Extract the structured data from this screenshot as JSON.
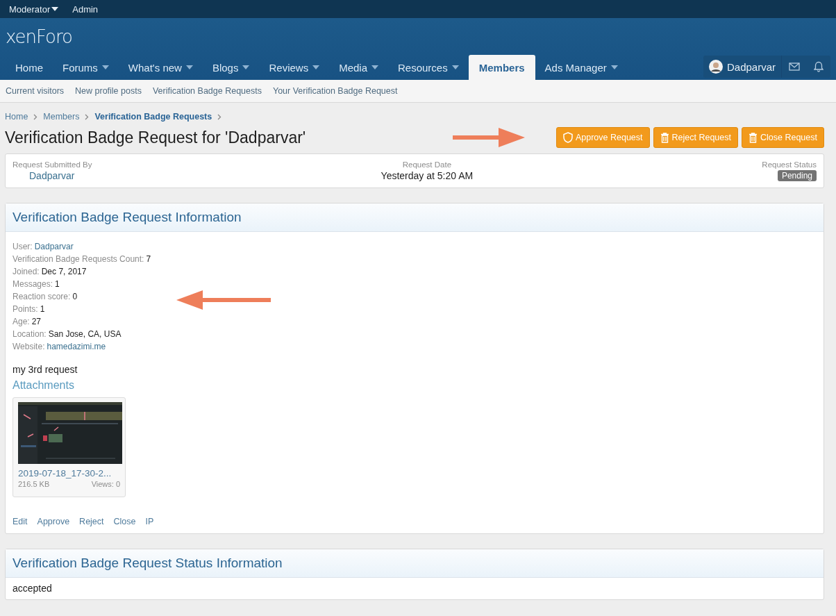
{
  "staff_bar": [
    {
      "label": "Moderator",
      "has_menu": true
    },
    {
      "label": "Admin",
      "has_menu": false
    }
  ],
  "logo": "xenForo",
  "nav": [
    {
      "label": "Home",
      "has_menu": false,
      "selected": false
    },
    {
      "label": "Forums",
      "has_menu": true,
      "selected": false
    },
    {
      "label": "What's new",
      "has_menu": true,
      "selected": false
    },
    {
      "label": "Blogs",
      "has_menu": true,
      "selected": false
    },
    {
      "label": "Reviews",
      "has_menu": true,
      "selected": false
    },
    {
      "label": "Media",
      "has_menu": true,
      "selected": false
    },
    {
      "label": "Resources",
      "has_menu": true,
      "selected": false
    },
    {
      "label": "Members",
      "has_menu": false,
      "selected": true
    },
    {
      "label": "Ads Manager",
      "has_menu": true,
      "selected": false
    }
  ],
  "user": {
    "name": "Dadparvar"
  },
  "sub_nav": [
    "Current visitors",
    "New profile posts",
    "Verification Badge Requests",
    "Your Verification Badge Request"
  ],
  "breadcrumb": [
    {
      "label": "Home",
      "current": false
    },
    {
      "label": "Members",
      "current": false
    },
    {
      "label": "Verification Badge Requests",
      "current": true
    }
  ],
  "title": "Verification Badge Request for 'Dadparvar'",
  "actions": [
    {
      "label": "Approve Request",
      "kind": "shield"
    },
    {
      "label": "Reject Request",
      "kind": "trash"
    },
    {
      "label": "Close Request",
      "kind": "trash"
    }
  ],
  "summary": {
    "submitted_by": {
      "label": "Request Submitted By",
      "value": "Dadparvar"
    },
    "date": {
      "label": "Request Date",
      "value": "Yesterday at 5:20 AM"
    },
    "status": {
      "label": "Request Status",
      "value": "Pending"
    }
  },
  "info": {
    "title": "Verification Badge Request Information",
    "rows": [
      {
        "label": "User:",
        "value": "Dadparvar",
        "kind": "link"
      },
      {
        "label": "Verification Badge Requests Count:",
        "value": "7",
        "kind": "plain"
      },
      {
        "label": "Joined:",
        "value": "Dec 7, 2017",
        "kind": "plain"
      },
      {
        "label": "Messages:",
        "value": "1",
        "kind": "plain"
      },
      {
        "label": "Reaction score:",
        "value": "0",
        "kind": "plain"
      },
      {
        "label": "Points:",
        "value": "1",
        "kind": "plain"
      },
      {
        "label": "Age:",
        "value": "27",
        "kind": "plain"
      },
      {
        "label": "Location:",
        "value": "San Jose, CA, USA",
        "kind": "plain"
      },
      {
        "label": "Website:",
        "value": "hamedazimi.me",
        "kind": "link"
      }
    ],
    "message": "my 3rd request",
    "attachments_title": "Attachments",
    "attachment": {
      "filename": "2019-07-18_17-30-2...",
      "size": "216.5 KB",
      "views": "Views: 0"
    },
    "links": [
      "Edit",
      "Approve",
      "Reject",
      "Close",
      "IP"
    ]
  },
  "status_info": {
    "title": "Verification Badge Request Status Information",
    "text": "accepted"
  }
}
